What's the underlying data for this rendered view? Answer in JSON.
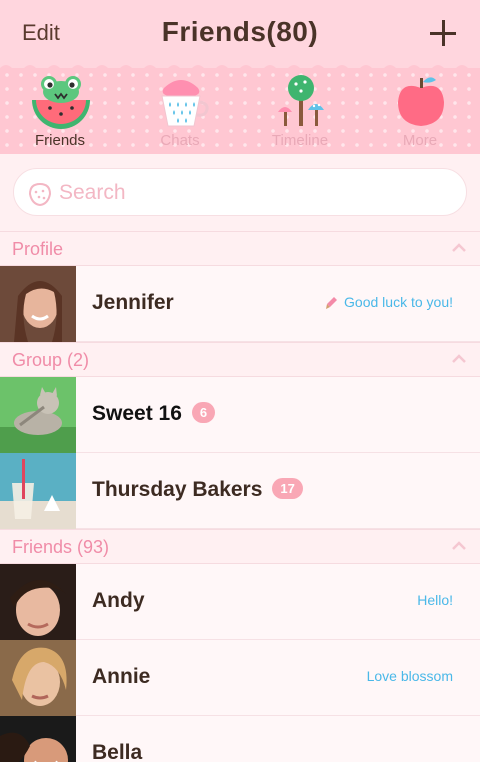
{
  "header": {
    "edit_label": "Edit",
    "title": "Friends(80)"
  },
  "tabs": [
    {
      "label": "Friends",
      "icon": "frog-watermelon-icon",
      "active": true
    },
    {
      "label": "Chats",
      "icon": "cupcake-cup-icon",
      "active": false
    },
    {
      "label": "Timeline",
      "icon": "mushroom-tree-icon",
      "active": false
    },
    {
      "label": "More",
      "icon": "apple-icon",
      "active": false
    }
  ],
  "search": {
    "placeholder": "Search"
  },
  "sections": {
    "profile": "Profile",
    "group": "Group (2)",
    "friends": "Friends (93)"
  },
  "profile": {
    "name": "Jennifer",
    "status": "Good luck to you!"
  },
  "groups": [
    {
      "name": "Sweet 16",
      "count": "6"
    },
    {
      "name": "Thursday Bakers",
      "count": "17"
    }
  ],
  "friends": [
    {
      "name": "Andy",
      "status": "Hello!"
    },
    {
      "name": "Annie",
      "status": "Love blossom"
    },
    {
      "name": "Bella",
      "status": ""
    }
  ],
  "colors": {
    "header_bg": "#ffd6de",
    "tab_bg": "#ffc7d2",
    "section_text": "#f08ca8",
    "status_text": "#4ab8e8",
    "badge_bg": "#f9a7b5"
  }
}
